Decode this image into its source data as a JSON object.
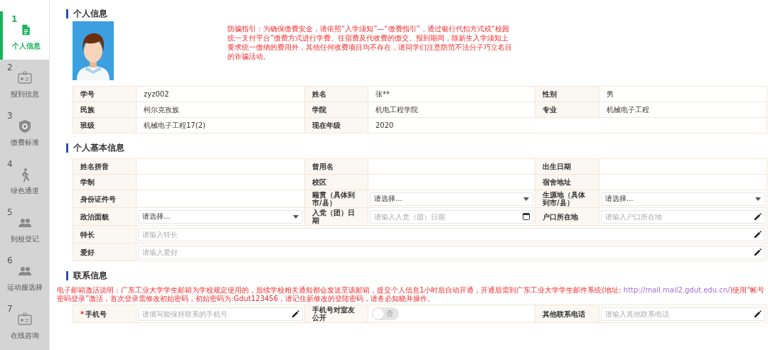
{
  "sidebar": {
    "items": [
      {
        "number": "1",
        "label": "个人信息",
        "selected": true
      },
      {
        "number": "2",
        "label": "报到信息",
        "selected": false
      },
      {
        "number": "3",
        "label": "缴费标准",
        "selected": false
      },
      {
        "number": "4",
        "label": "绿色通道",
        "selected": false
      },
      {
        "number": "5",
        "label": "到校登记",
        "selected": false
      },
      {
        "number": "6",
        "label": "运动服选择",
        "selected": false
      },
      {
        "number": "7",
        "label": "在线咨询",
        "selected": false
      }
    ]
  },
  "personal_info": {
    "title": "个人信息",
    "photo": {
      "kind": "picture"
    },
    "notice": "防骗指引：为确保缴费安全，请依照“入学须知”—“缴费指引”，通过银行代扣方式或“校园统一支付平台”缴费方式进行学费、住宿费及代收费的缴交。报到期间，除新生入学须知上要求统一缴纳的费用外，其他任何收费项目均不存在，请同学们注意防范不法分子巧立名目的诈骗活动。",
    "rows": [
      [
        {
          "kind": "label",
          "text": "学号"
        },
        {
          "kind": "text",
          "text": "zyz002"
        },
        {
          "kind": "label",
          "text": "姓名"
        },
        {
          "kind": "text",
          "text": "张**"
        },
        {
          "kind": "label",
          "text": "性别"
        },
        {
          "kind": "text",
          "text": "男"
        }
      ],
      [
        {
          "kind": "label",
          "text": "民族"
        },
        {
          "kind": "text",
          "text": "柯尔克孜族"
        },
        {
          "kind": "label",
          "text": "学院"
        },
        {
          "kind": "text",
          "text": "机电工程学院"
        },
        {
          "kind": "label",
          "text": "专业"
        },
        {
          "kind": "text",
          "text": "机械电子工程"
        }
      ],
      [
        {
          "kind": "label",
          "text": "班级"
        },
        {
          "kind": "text",
          "text": "机械电子工程17(2)"
        },
        {
          "kind": "label",
          "text": "现在年级"
        },
        {
          "kind": "text",
          "text": "2020"
        }
      ]
    ]
  },
  "basic_info": {
    "title": "个人基本信息",
    "rows": [
      [
        {
          "kind": "label",
          "text": "姓名拼音"
        },
        {
          "kind": "empty"
        },
        {
          "kind": "label",
          "text": "曾用名"
        },
        {
          "kind": "empty"
        },
        {
          "kind": "label",
          "text": "出生日期"
        },
        {
          "kind": "empty"
        }
      ],
      [
        {
          "kind": "label",
          "text": "学制"
        },
        {
          "kind": "empty"
        },
        {
          "kind": "label",
          "text": "校区"
        },
        {
          "kind": "empty"
        },
        {
          "kind": "label",
          "text": "宿舍地址"
        },
        {
          "kind": "empty"
        }
      ],
      [
        {
          "kind": "label",
          "text": "身份证件号"
        },
        {
          "kind": "empty"
        },
        {
          "kind": "label",
          "text": "籍贯（具体到市/县）"
        },
        {
          "kind": "select",
          "value": "请选择..."
        },
        {
          "kind": "label",
          "text": "生源地（具体到市/县）"
        },
        {
          "kind": "select",
          "value": "请选择..."
        }
      ],
      [
        {
          "kind": "label",
          "text": "政治面貌"
        },
        {
          "kind": "select",
          "value": "请选择..."
        },
        {
          "kind": "label",
          "text": "入党（团）日期"
        },
        {
          "kind": "date",
          "placeholder": "请输入入党（团）日期"
        },
        {
          "kind": "label",
          "text": "户口所在地"
        },
        {
          "kind": "input",
          "placeholder": "请输入户口所在地"
        }
      ],
      [
        {
          "kind": "label",
          "text": "特长"
        },
        {
          "kind": "input",
          "placeholder": "请输入特长"
        }
      ],
      [
        {
          "kind": "label",
          "text": "爱好"
        },
        {
          "kind": "input",
          "placeholder": "请输入爱好"
        }
      ]
    ]
  },
  "contact_info": {
    "title": "联系信息",
    "notice_before": "电子邮箱激活说明：广东工业大学学生邮箱为学校规定使用的，后续学校相关通知都会发送至该邮箱，提交个人信息1小时后自动开通，开通后需到广东工业大学学生邮件系统(地址: ",
    "notice_link": "http://mail.mail2.gdut.edu.cn/",
    "notice_after": ")使用“帐号密码登录”激活，首次登录需修改初始密码，初始密码为:Gdut123456，请记住新修改的登陆密码，请务必知晓并操作。",
    "rows": [
      [
        {
          "kind": "label",
          "text": "手机号",
          "required_mark": "*"
        },
        {
          "kind": "input",
          "placeholder": "请填写能保持联系的手机号"
        },
        {
          "kind": "label",
          "text": "手机号对室友公开"
        },
        {
          "kind": "toggle",
          "on": false,
          "text": "否"
        },
        {
          "kind": "label",
          "text": "其他联系电话"
        },
        {
          "kind": "input",
          "placeholder": "请输入其他联系电话"
        }
      ]
    ]
  }
}
